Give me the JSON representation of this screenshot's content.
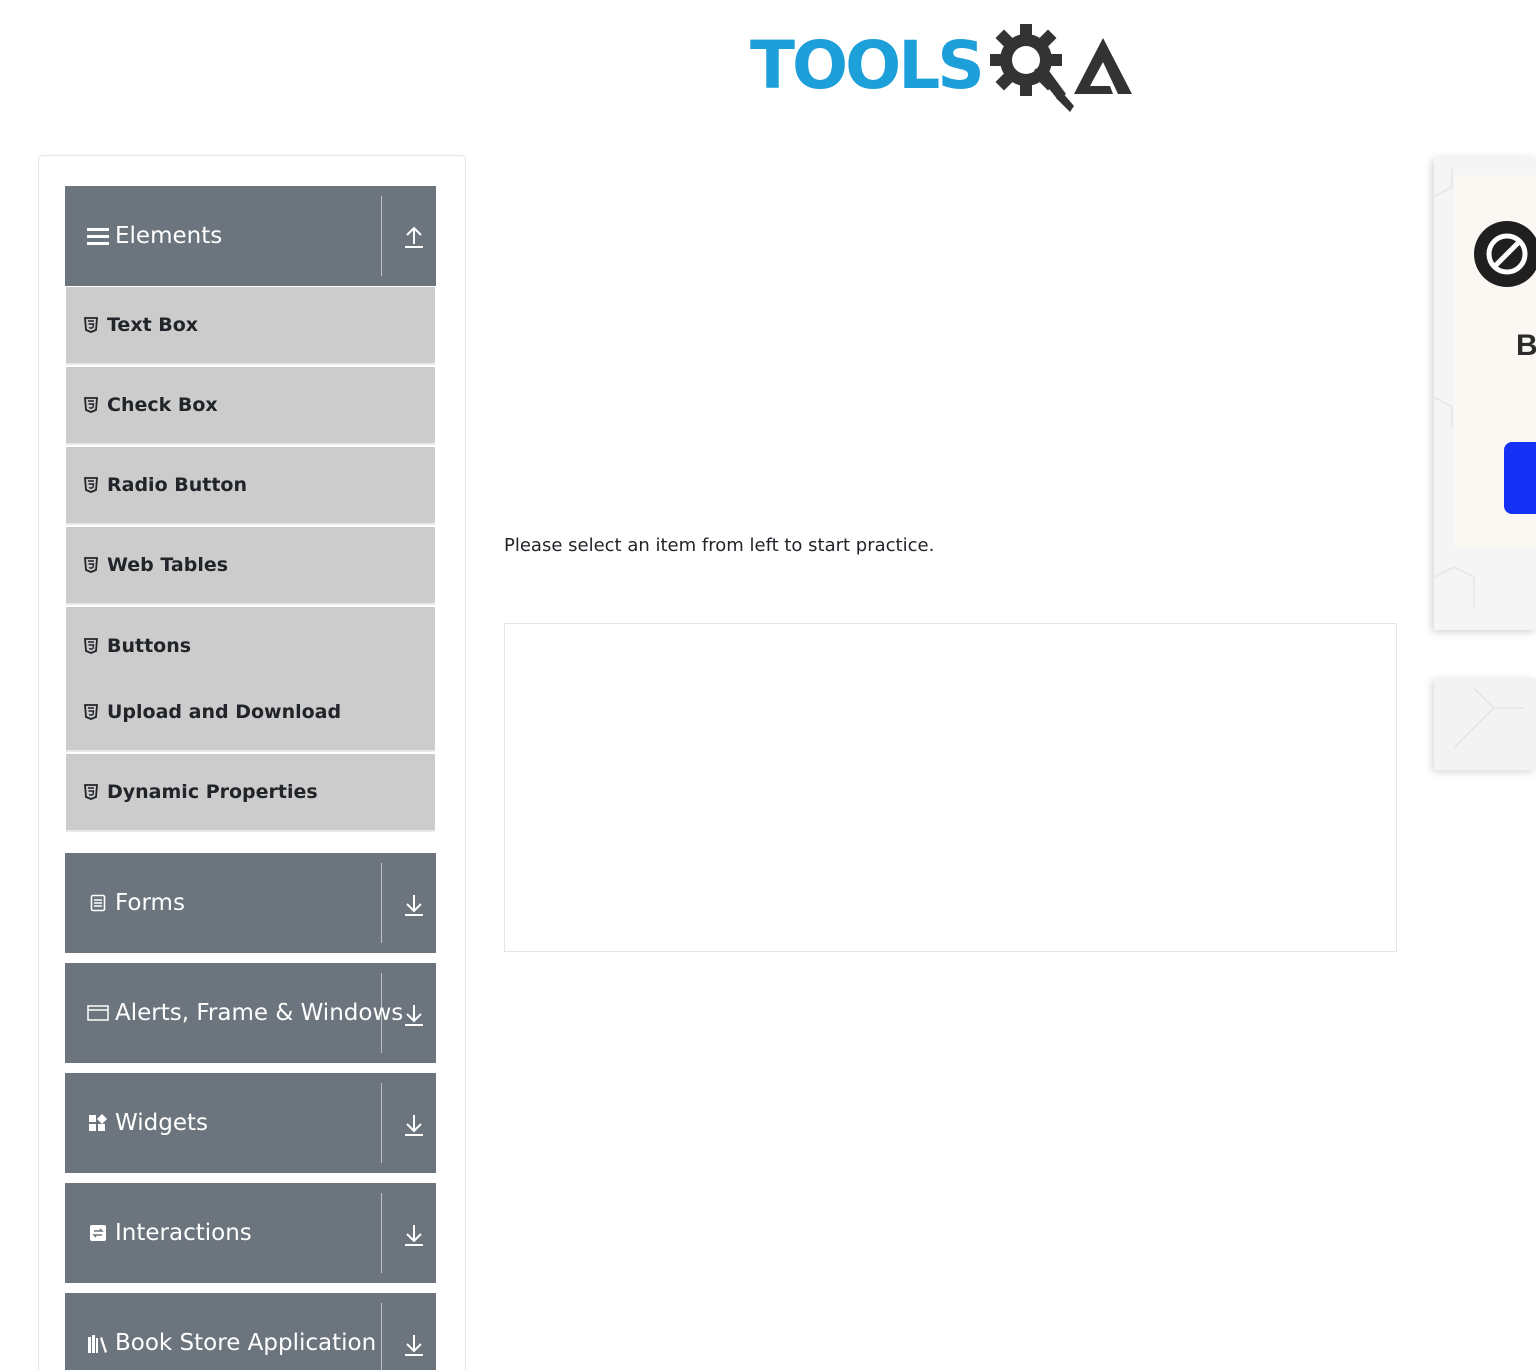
{
  "header": {
    "logo_text": "TOOLSQA"
  },
  "sidebar": {
    "groups": [
      {
        "label": "Elements",
        "icon": "hamburger-icon",
        "expanded": true
      },
      {
        "label": "Forms",
        "icon": "document-icon",
        "expanded": false
      },
      {
        "label": "Alerts, Frame & Windows",
        "icon": "window-icon",
        "expanded": false
      },
      {
        "label": "Widgets",
        "icon": "widgets-icon",
        "expanded": false
      },
      {
        "label": "Interactions",
        "icon": "swap-icon",
        "expanded": false
      },
      {
        "label": "Book Store Application",
        "icon": "books-icon",
        "expanded": false
      }
    ],
    "items": [
      {
        "label": "Text Box",
        "icon": "html5-icon"
      },
      {
        "label": "Check Box",
        "icon": "html5-icon"
      },
      {
        "label": "Radio Button",
        "icon": "html5-icon"
      },
      {
        "label": "Web Tables",
        "icon": "html5-icon"
      },
      {
        "label": "Buttons",
        "icon": "html5-icon"
      },
      {
        "label": "Upload and Download",
        "icon": "html5-icon"
      },
      {
        "label": "Dynamic Properties",
        "icon": "html5-icon"
      }
    ]
  },
  "main": {
    "message": "Please select an item from left to start practice."
  },
  "ad": {
    "letter": "B"
  },
  "colors": {
    "group_bg": "#6c757d",
    "item_bg": "#cccccc",
    "logo_blue": "#1d9fd9",
    "logo_dark": "#333333",
    "ad_button": "#1531f5"
  }
}
